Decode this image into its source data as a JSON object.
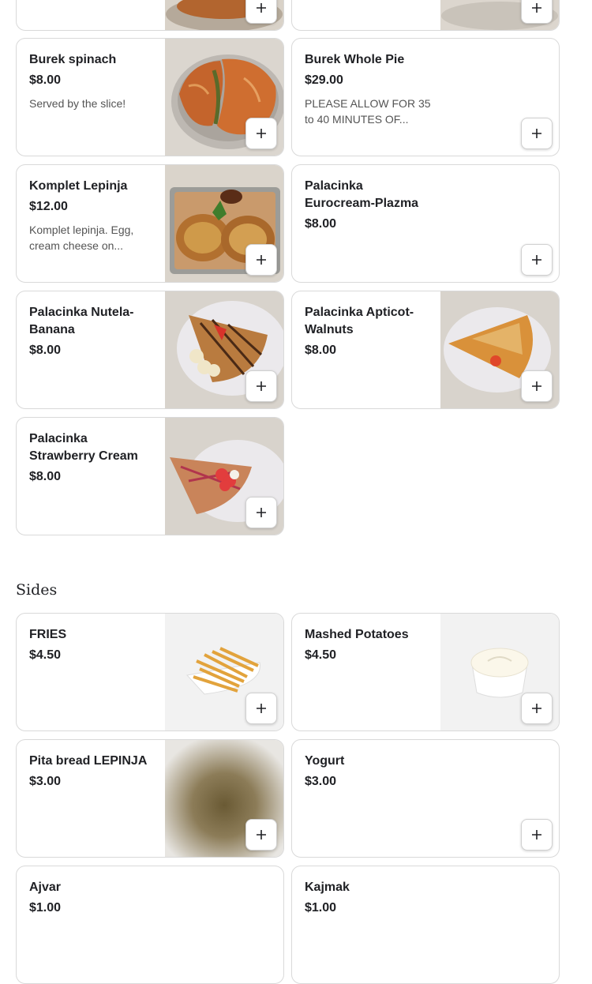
{
  "icons": {
    "add": "plus-icon"
  },
  "colors": {
    "border": "#d9d9d9",
    "text": "#202125",
    "muted": "#545454"
  },
  "top_cards": [
    {
      "name": "",
      "price": "",
      "desc": ""
    },
    {
      "name": "",
      "price": "",
      "desc": ""
    }
  ],
  "items": [
    {
      "name": "Burek spinach",
      "price": "$8.00",
      "desc": "Served by the slice!",
      "image": "burek-spinach-photo"
    },
    {
      "name": "Burek Whole Pie",
      "price": "$29.00",
      "desc": "PLEASE ALLOW FOR 35 to 40 MINUTES OF..."
    },
    {
      "name": "Komplet Lepinja",
      "price": "$12.00",
      "desc": "Komplet lepinja. Egg, cream cheese on...",
      "image": "komplet-lepinja-photo"
    },
    {
      "name": "Palacinka Eurocream-Plazma",
      "price": "$8.00",
      "desc": ""
    },
    {
      "name": "Palacinka Nutela-Banana",
      "price": "$8.00",
      "desc": "",
      "image": "palacinka-nutella-banana-photo"
    },
    {
      "name": "Palacinka Apticot-Walnuts",
      "price": "$8.00",
      "desc": "",
      "image": "palacinka-apricot-walnuts-photo"
    },
    {
      "name": "Palacinka Strawberry Cream",
      "price": "$8.00",
      "desc": "",
      "image": "palacinka-strawberry-cream-photo"
    }
  ],
  "sides": {
    "title": "Sides",
    "items": [
      {
        "name": "FRIES",
        "price": "$4.50",
        "image": "fries-photo"
      },
      {
        "name": "Mashed Potatoes",
        "price": "$4.50",
        "image": "mashed-potatoes-photo"
      },
      {
        "name": "Pita bread LEPINJA",
        "price": "$3.00",
        "image": "pita-bread-photo"
      },
      {
        "name": "Yogurt",
        "price": "$3.00"
      },
      {
        "name": "Ajvar",
        "price": "$1.00"
      },
      {
        "name": "Kajmak",
        "price": "$1.00"
      }
    ]
  }
}
